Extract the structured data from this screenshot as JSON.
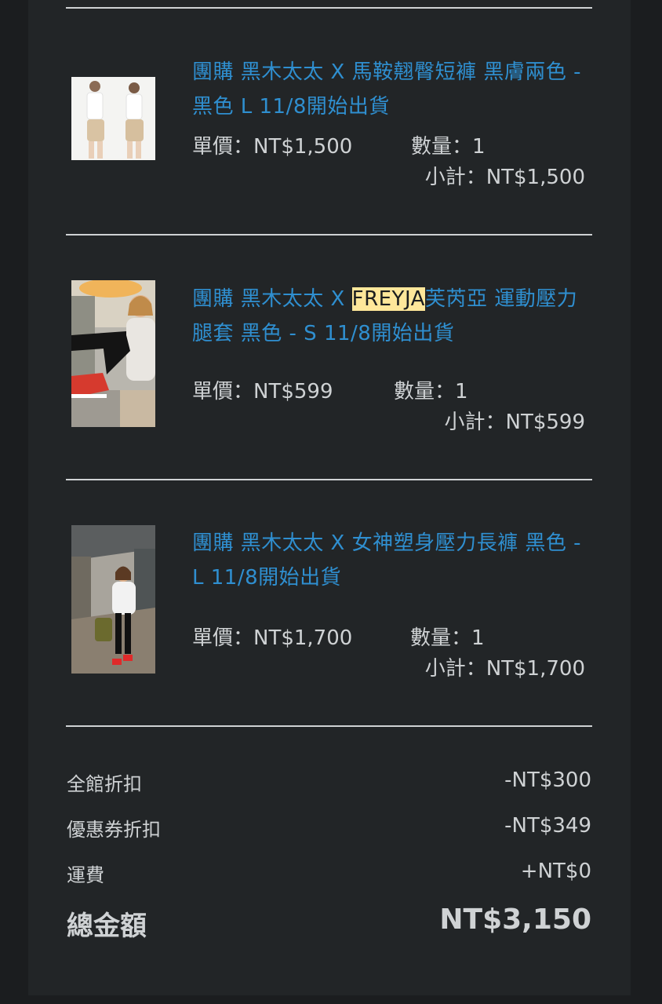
{
  "items": [
    {
      "name_prefix": "團購 黑木太太 X 馬鞍翹臀短褲 黑膚兩色 - 黑色 L 11/8開始出貨",
      "unit_price": "單價：NT$1,500",
      "quantity": "數量：1",
      "subtotal": "小計：NT$1,500"
    },
    {
      "name_before": "團購 黑木太太 X ",
      "name_highlight": "FREYJA",
      "name_after": "芙芮亞 運動壓力腿套 黑色 - S 11/8開始出貨",
      "unit_price": "單價：NT$599",
      "quantity": "數量：1",
      "subtotal": "小計：NT$599"
    },
    {
      "name_prefix": "團購 黑木太太 X 女神塑身壓力長褲 黑色 - L 11/8開始出貨",
      "unit_price": "單價：NT$1,700",
      "quantity": "數量：1",
      "subtotal": "小計：NT$1,700"
    }
  ],
  "summary": {
    "store_discount_label": "全館折扣",
    "store_discount_value": "-NT$300",
    "coupon_discount_label": "優惠券折扣",
    "coupon_discount_value": "-NT$349",
    "shipping_label": "運費",
    "shipping_value": "+NT$0",
    "total_label": "總金額",
    "total_value": "NT$3,150"
  },
  "colors": {
    "link": "#2f8fd0",
    "highlight": "#ffe79a",
    "text": "#cfd2d4",
    "panel": "#222527",
    "background": "#1b1d1f"
  }
}
